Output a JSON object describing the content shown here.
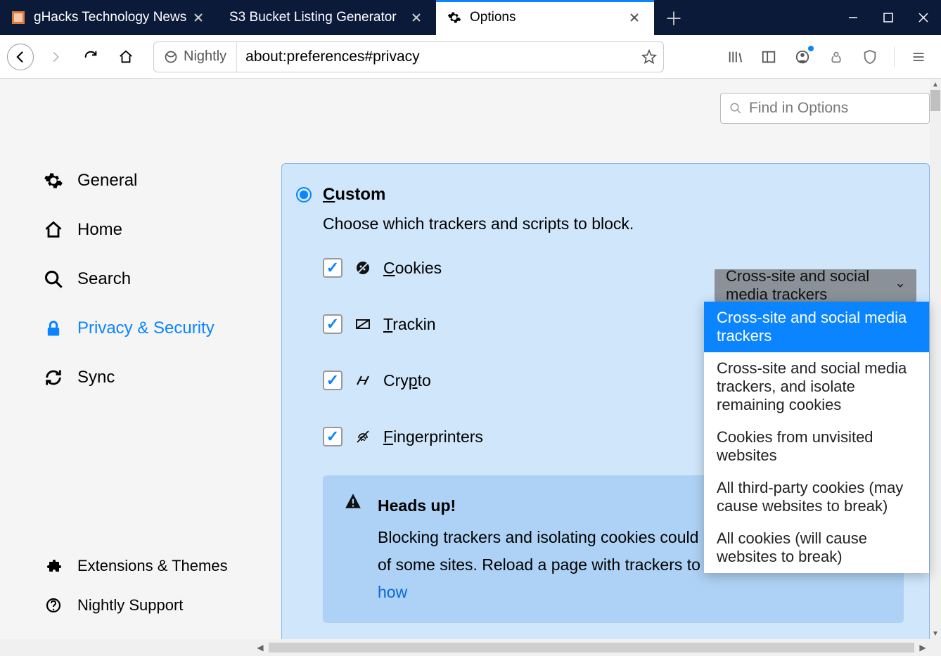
{
  "tabs": [
    {
      "title": "gHacks Technology News"
    },
    {
      "title": "S3 Bucket Listing Generator"
    },
    {
      "title": "Options"
    }
  ],
  "address": {
    "identity": "Nightly",
    "url": "about:preferences#privacy"
  },
  "find_placeholder": "Find in Options",
  "sidebar": {
    "items": [
      {
        "label": "General"
      },
      {
        "label": "Home"
      },
      {
        "label": "Search"
      },
      {
        "label": "Privacy & Security"
      },
      {
        "label": "Sync"
      }
    ],
    "bottom": [
      {
        "label": "Extensions & Themes"
      },
      {
        "label": "Nightly Support"
      }
    ]
  },
  "custom": {
    "title": "Custom",
    "desc": "Choose which trackers and scripts to block.",
    "rows": {
      "cookies": "Cookies",
      "tracking": "Trackin",
      "crypto": "Crypto",
      "fingerprinters": "Fingerprinters"
    },
    "select_value": "Cross-site and social media trackers",
    "options": [
      "Cross-site and social media trackers",
      "Cross-site and social media trackers, and isolate remaining cookies",
      "Cookies from unvisited websites",
      "All third-party cookies (may cause websites to break)",
      "All cookies (will cause websites to break)"
    ]
  },
  "warning": {
    "title": "Heads up!",
    "body": "Blocking trackers and isolating cookies could impact the functionality of some sites. Reload a page with trackers to load all content.",
    "link": "Learn how"
  }
}
